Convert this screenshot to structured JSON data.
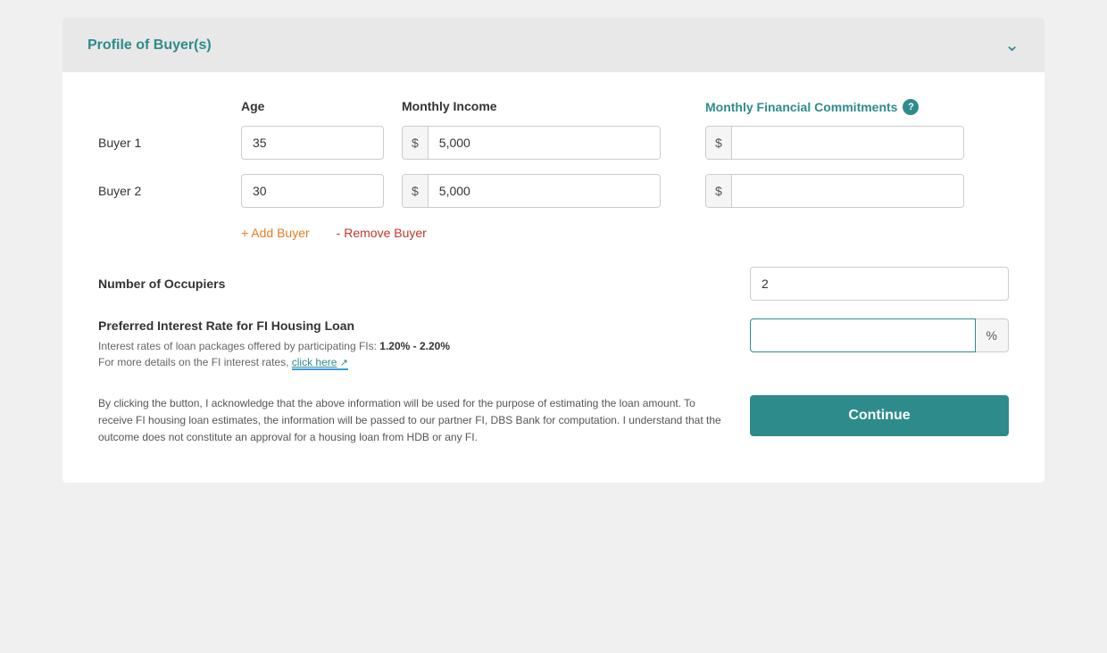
{
  "header": {
    "title": "Profile of Buyer(s)",
    "chevron": "⌄"
  },
  "columns": {
    "age": "Age",
    "monthly_income": "Monthly Income",
    "monthly_financial_commitments": "Monthly Financial Commitments"
  },
  "buyers": [
    {
      "label": "Buyer 1",
      "age": "35",
      "monthly_income": "5,000",
      "monthly_financial_commitments": ""
    },
    {
      "label": "Buyer 2",
      "age": "30",
      "monthly_income": "5,000",
      "monthly_financial_commitments": ""
    }
  ],
  "actions": {
    "add_buyer": "+ Add Buyer",
    "remove_buyer": "- Remove Buyer"
  },
  "occupiers": {
    "label": "Number of Occupiers",
    "value": "2"
  },
  "interest_rate": {
    "label": "Preferred Interest Rate for FI Housing Loan",
    "info_line1": "Interest rates of loan packages offered by participating FIs: ",
    "rate_range": "1.20% - 2.20%",
    "info_line2": "For more details on the FI interest rates, ",
    "click_here": "click here",
    "value": "",
    "percent": "%"
  },
  "disclaimer": {
    "text": "By clicking the button, I acknowledge that the above information will be used for the purpose of estimating the loan amount. To receive FI housing loan estimates, the information will be passed to our partner FI, DBS Bank for computation. I understand that the outcome does not constitute an approval for a housing loan from HDB or any FI.",
    "button_label": "Continue"
  },
  "currency_symbol": "$"
}
